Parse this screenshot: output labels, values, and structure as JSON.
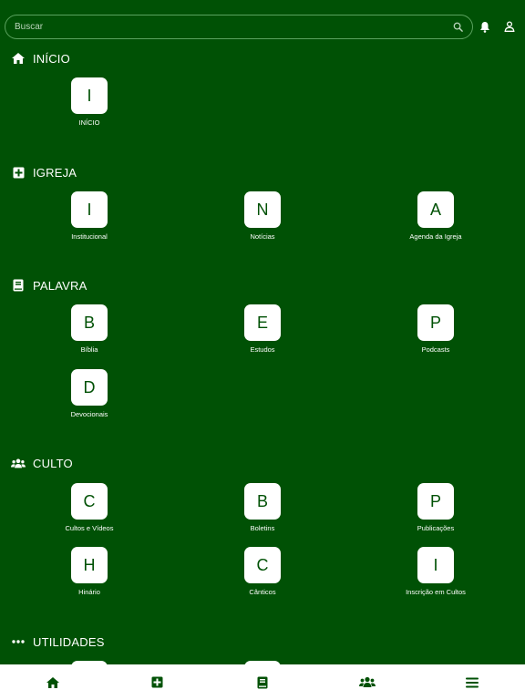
{
  "search": {
    "placeholder": "Buscar"
  },
  "icons": {
    "search": "search-icon",
    "bell": "bell-icon",
    "user": "user-icon"
  },
  "colors": {
    "background": "#005105",
    "tile": "#ffffff",
    "tile_text": "#005105",
    "bottom_icon": "#005105"
  },
  "sections": {
    "inicio": {
      "title": "INÍCIO",
      "icon": "home-icon",
      "items": [
        {
          "letter": "I",
          "label": "INÍCIO"
        }
      ]
    },
    "igreja": {
      "title": "IGREJA",
      "icon": "plus-square-icon",
      "items": [
        {
          "letter": "I",
          "label": "Institucional"
        },
        {
          "letter": "N",
          "label": "Notícias"
        },
        {
          "letter": "A",
          "label": "Agenda da Igreja"
        }
      ]
    },
    "palavra": {
      "title": "PALAVRA",
      "icon": "book-icon",
      "items": [
        {
          "letter": "B",
          "label": "Bíblia"
        },
        {
          "letter": "E",
          "label": "Estudos"
        },
        {
          "letter": "P",
          "label": "Podcasts"
        },
        {
          "letter": "D",
          "label": "Devocionais"
        }
      ]
    },
    "culto": {
      "title": "CULTO",
      "icon": "users-icon",
      "items": [
        {
          "letter": "C",
          "label": "Cultos e Vídeos"
        },
        {
          "letter": "B",
          "label": "Boletins"
        },
        {
          "letter": "P",
          "label": "Publicações"
        },
        {
          "letter": "H",
          "label": "Hinário"
        },
        {
          "letter": "C",
          "label": "Cânticos"
        },
        {
          "letter": "I",
          "label": "Inscrição em Cultos"
        }
      ]
    },
    "utilidades": {
      "title": "UTILIDADES",
      "icon": "ellipsis-icon"
    }
  },
  "bottom_nav": [
    "home-icon",
    "plus-square-icon",
    "book-icon",
    "users-icon",
    "menu-icon"
  ]
}
